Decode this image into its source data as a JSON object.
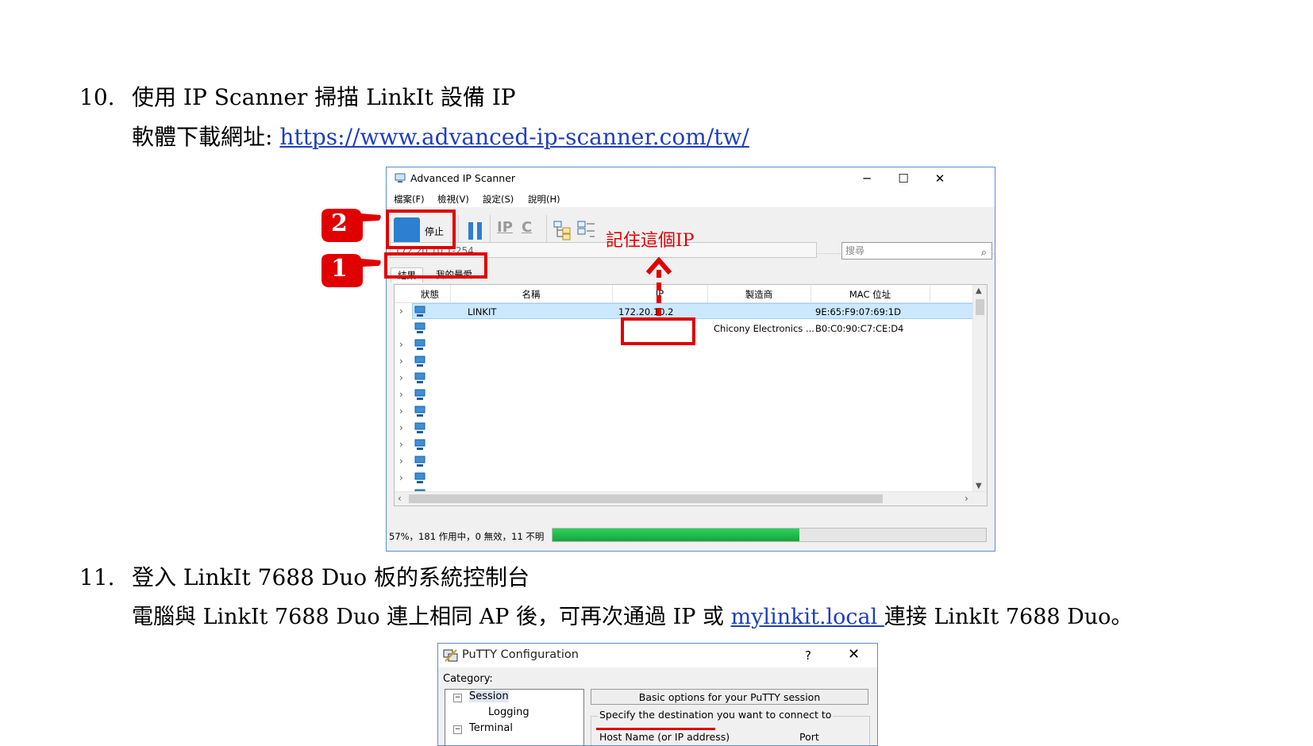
{
  "doc": {
    "step10_num": "10.",
    "step10_title": "使用 IP Scanner 掃描 LinkIt 設備 IP",
    "download_label": "軟體下載網址: ",
    "download_url": "https://www.advanced-ip-scanner.com/tw/",
    "step11_num": "11.",
    "step11_title": "登入 LinkIt 7688 Duo 板的系統控制台",
    "step11_text_before": "電腦與 LinkIt 7688 Duo 連上相同 AP 後，可再次通過 IP 或 ",
    "step11_link": "mylinkit.local ",
    "step11_text_after": "連接 LinkIt 7688 Duo。"
  },
  "ip_scanner": {
    "title": "Advanced IP Scanner",
    "window_controls": {
      "minimize": "─",
      "maximize": "☐",
      "close": "✕"
    },
    "menu": [
      "檔案(F)",
      "檢視(V)",
      "設定(S)",
      "說明(H)"
    ],
    "toolbar": {
      "stop_label": "停止",
      "ip_label": "IP",
      "c_label": "C"
    },
    "range_value": "172.20.10.1-254",
    "search_placeholder": "搜尋",
    "tabs": [
      "結果",
      "我的最愛"
    ],
    "columns": [
      "狀態",
      "名稱",
      "IP",
      "製造商",
      "MAC 位址"
    ],
    "rows": [
      {
        "name": "LINKIT",
        "ip": "172.20.10.2",
        "manufacturer": "",
        "mac": "9E:65:F9:07:69:1D",
        "selected": true
      },
      {
        "name": "",
        "ip": "",
        "manufacturer": "Chicony Electronics ...",
        "mac": "B0:C0:90:C7:CE:D4",
        "selected": false
      }
    ],
    "blank_rows": 10,
    "status_text": "57%，181 作用中，0 無效，11 不明",
    "progress_percent": 57
  },
  "annotations": {
    "hand_1": "1",
    "hand_2": "2",
    "remember_note": "記住這個IP",
    "accent_color": "#e00000"
  },
  "putty": {
    "title": "PuTTY Configuration",
    "help": "?",
    "close": "✕",
    "category_label": "Category:",
    "tree": [
      "Session",
      "Logging",
      "Terminal"
    ],
    "section_header": "Basic options for your PuTTY session",
    "group_label": "Specify the destination you want to connect to",
    "host_label": "Host Name (or IP address)",
    "port_label": "Port"
  }
}
